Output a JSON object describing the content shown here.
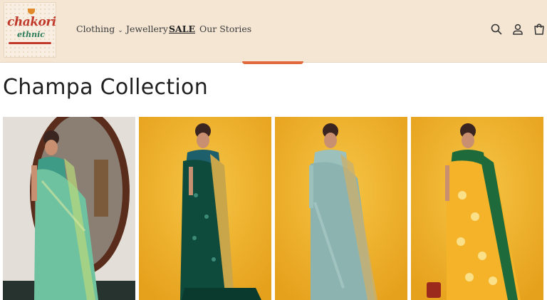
{
  "brand": {
    "logo_line1": "chakori",
    "logo_line2": "ethnic"
  },
  "nav": {
    "items": [
      {
        "label": "Clothing",
        "has_dropdown": true
      },
      {
        "label": "Jewellery",
        "has_dropdown": false
      },
      {
        "label": "SALE",
        "has_dropdown": false
      },
      {
        "label": "Our Stories",
        "has_dropdown": false
      }
    ]
  },
  "header_icons": [
    "search-icon",
    "account-icon",
    "cart-icon"
  ],
  "page": {
    "title": "Champa Collection"
  },
  "products": [
    {
      "saree_color": "#6fc2a0",
      "blouse_color": "#3e9b86",
      "background": "#cfcac2"
    },
    {
      "saree_color": "#0f4b3c",
      "blouse_color": "#1d5f6a",
      "background": "#f0b12a"
    },
    {
      "saree_color": "#8cb3b0",
      "blouse_color": "#9cc1bc",
      "background": "#f0b12a"
    },
    {
      "saree_color": "#f5b329",
      "blouse_color": "#1f6a3a",
      "background": "#f0b12a"
    }
  ],
  "colors": {
    "header_bg": "#f5e6d4",
    "accent": "#e0683a",
    "text": "#1f1f1f"
  }
}
